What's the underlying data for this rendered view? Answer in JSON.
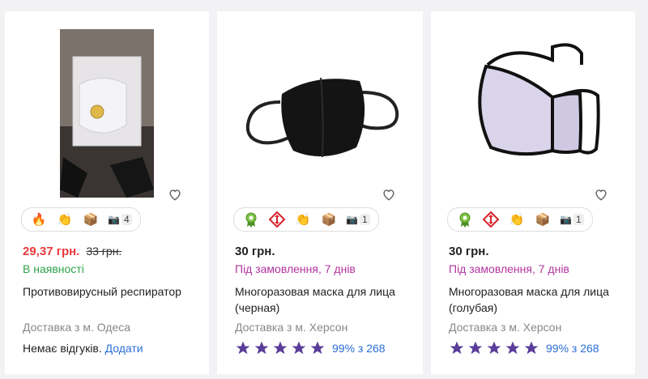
{
  "products": [
    {
      "price": "29,37 грн.",
      "old_price": "33 грн.",
      "availability": "В наявності",
      "title": "Противовирусный респиратор",
      "delivery": "Доставка з м. Одеса",
      "reviews_text": "Немає відгуків.",
      "reviews_link": "Додати",
      "photo_count": "4"
    },
    {
      "price": "30 грн.",
      "availability": "Під замовлення, 7 днів",
      "title": "Многоразовая маска для лица (черная)",
      "delivery": "Доставка з м. Херсон",
      "rating": "99% з 268",
      "photo_count": "1"
    },
    {
      "price": "30 грн.",
      "availability": "Під замовлення, 7 днів",
      "title": "Многоразовая маска для лица (голубая)",
      "delivery": "Доставка з м. Херсон",
      "rating": "99% з 268",
      "photo_count": "1"
    }
  ],
  "icons": {
    "heart": "heart-icon",
    "fire": "fire-icon",
    "applause": "clapping-hands-icon",
    "package": "package-icon",
    "camera": "camera-icon",
    "award": "award-ribbon-icon",
    "delivery_service": "nova-poshta-icon",
    "star": "star-icon"
  },
  "colors": {
    "price_sale": "#e8393c",
    "in_stock": "#2fa34a",
    "on_order": "#b3339f",
    "link": "#2a6fd6",
    "star": "#5b3d9a"
  }
}
